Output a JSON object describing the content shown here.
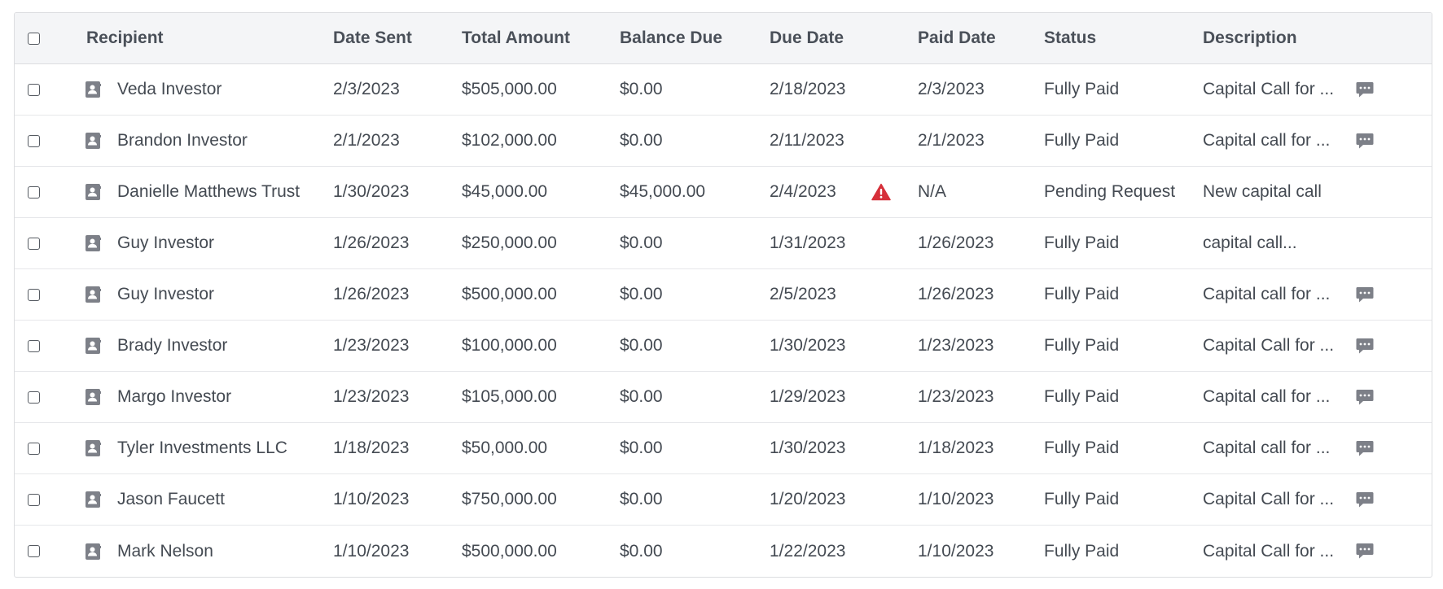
{
  "table": {
    "headers": {
      "recipient": "Recipient",
      "date_sent": "Date Sent",
      "total_amount": "Total Amount",
      "balance_due": "Balance Due",
      "due_date": "Due Date",
      "paid_date": "Paid Date",
      "status": "Status",
      "description": "Description"
    },
    "rows": [
      {
        "recipient": "Veda Investor",
        "date_sent": "2/3/2023",
        "total_amount": "$505,000.00",
        "balance_due": "$0.00",
        "due_date": "2/18/2023",
        "paid_date": "2/3/2023",
        "status": "Fully Paid",
        "description": "Capital Call for ...",
        "has_note": true,
        "overdue": false
      },
      {
        "recipient": "Brandon Investor",
        "date_sent": "2/1/2023",
        "total_amount": "$102,000.00",
        "balance_due": "$0.00",
        "due_date": "2/11/2023",
        "paid_date": "2/1/2023",
        "status": "Fully Paid",
        "description": "Capital call for ...",
        "has_note": true,
        "overdue": false
      },
      {
        "recipient": "Danielle Matthews Trust",
        "date_sent": "1/30/2023",
        "total_amount": "$45,000.00",
        "balance_due": "$45,000.00",
        "due_date": "2/4/2023",
        "paid_date": "N/A",
        "status": "Pending Request",
        "description": "New capital call",
        "has_note": false,
        "overdue": true
      },
      {
        "recipient": "Guy Investor",
        "date_sent": "1/26/2023",
        "total_amount": "$250,000.00",
        "balance_due": "$0.00",
        "due_date": "1/31/2023",
        "paid_date": "1/26/2023",
        "status": "Fully Paid",
        "description": "capital call...",
        "has_note": false,
        "overdue": false
      },
      {
        "recipient": "Guy Investor",
        "date_sent": "1/26/2023",
        "total_amount": "$500,000.00",
        "balance_due": "$0.00",
        "due_date": "2/5/2023",
        "paid_date": "1/26/2023",
        "status": "Fully Paid",
        "description": "Capital call for ...",
        "has_note": true,
        "overdue": false
      },
      {
        "recipient": "Brady Investor",
        "date_sent": "1/23/2023",
        "total_amount": "$100,000.00",
        "balance_due": "$0.00",
        "due_date": "1/30/2023",
        "paid_date": "1/23/2023",
        "status": "Fully Paid",
        "description": "Capital Call for ...",
        "has_note": true,
        "overdue": false
      },
      {
        "recipient": "Margo Investor",
        "date_sent": "1/23/2023",
        "total_amount": "$105,000.00",
        "balance_due": "$0.00",
        "due_date": "1/29/2023",
        "paid_date": "1/23/2023",
        "status": "Fully Paid",
        "description": "Capital call for ...",
        "has_note": true,
        "overdue": false
      },
      {
        "recipient": "Tyler Investments LLC",
        "date_sent": "1/18/2023",
        "total_amount": "$50,000.00",
        "balance_due": "$0.00",
        "due_date": "1/30/2023",
        "paid_date": "1/18/2023",
        "status": "Fully Paid",
        "description": "Capital call for ...",
        "has_note": true,
        "overdue": false
      },
      {
        "recipient": "Jason Faucett",
        "date_sent": "1/10/2023",
        "total_amount": "$750,000.00",
        "balance_due": "$0.00",
        "due_date": "1/20/2023",
        "paid_date": "1/10/2023",
        "status": "Fully Paid",
        "description": "Capital Call for ...",
        "has_note": true,
        "overdue": false
      },
      {
        "recipient": "Mark Nelson",
        "date_sent": "1/10/2023",
        "total_amount": "$500,000.00",
        "balance_due": "$0.00",
        "due_date": "1/22/2023",
        "paid_date": "1/10/2023",
        "status": "Fully Paid",
        "description": "Capital Call for ...",
        "has_note": true,
        "overdue": false
      }
    ]
  },
  "icons": {
    "contact": "contact-card-icon",
    "note": "comment-icon",
    "warning": "warning-triangle-icon"
  },
  "colors": {
    "warning": "#d6303a",
    "icon_gray": "#7d8088",
    "header_bg": "#f4f5f7"
  }
}
